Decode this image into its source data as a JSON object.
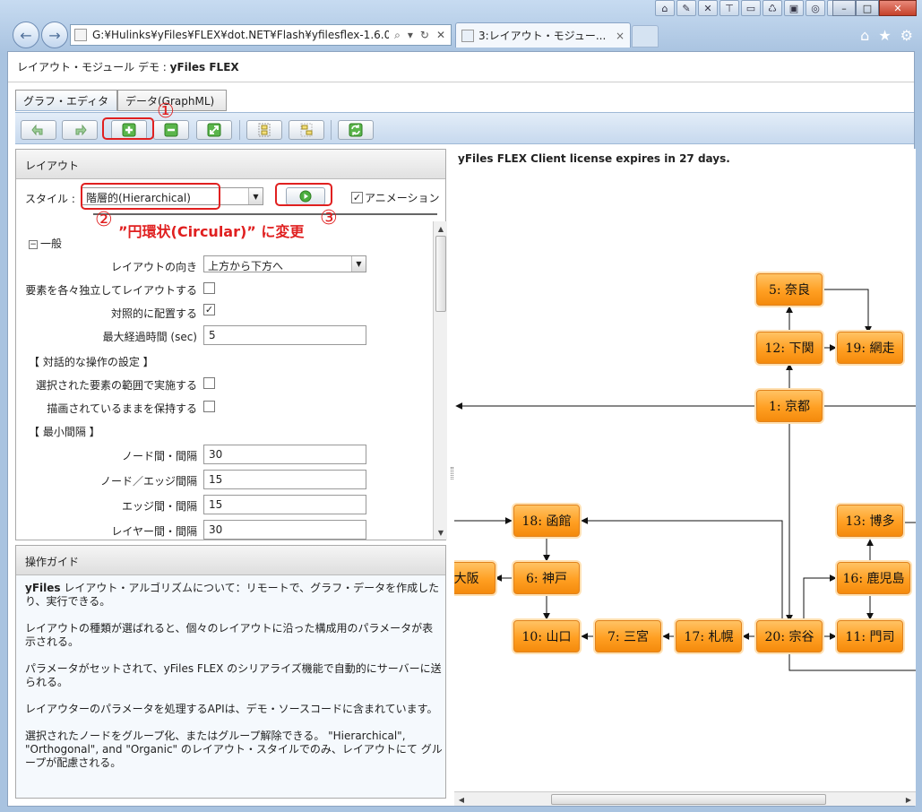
{
  "browser": {
    "address": "G:¥Hulinks¥yFiles¥FLEX¥dot.NET¥Flash¥yfilesflex-1.6.0.",
    "tab_title": "3:レイアウト・モジュー...",
    "tab_close": "×"
  },
  "app": {
    "title_prefix": "レイアウト・モジュール デモ : ",
    "title_product": "yFiles FLEX",
    "tabs": [
      "グラフ・エディタ",
      "データ(GraphML)"
    ]
  },
  "layout_panel": {
    "header": "レイアウト",
    "style_label": "スタイル :",
    "style_value": "階層的(Hierarchical)",
    "animation_label": "アニメーション",
    "animation_checked": true,
    "section_general": "一般",
    "rows": [
      {
        "label": "レイアウトの向き",
        "type": "select",
        "value": "上方から下方へ"
      },
      {
        "label": "要素を各々独立してレイアウトする",
        "type": "checkbox",
        "checked": false
      },
      {
        "label": "対照的に配置する",
        "type": "checkbox",
        "checked": true
      },
      {
        "label": "最大経過時間 (sec)",
        "type": "input",
        "value": "5"
      },
      {
        "label": "【 対話的な操作の設定 】",
        "type": "section"
      },
      {
        "label": "選択された要素の範囲で実施する",
        "type": "checkbox",
        "checked": false
      },
      {
        "label": "描画されているままを保持する",
        "type": "checkbox",
        "checked": false
      },
      {
        "label": "【 最小間隔 】",
        "type": "section"
      },
      {
        "label": "ノード間・間隔",
        "type": "input",
        "value": "30"
      },
      {
        "label": "ノード／エッジ間隔",
        "type": "input",
        "value": "15"
      },
      {
        "label": "エッジ間・間隔",
        "type": "input",
        "value": "15"
      },
      {
        "label": "レイヤー間・間隔",
        "type": "input",
        "value": "30"
      }
    ]
  },
  "guide_panel": {
    "header": "操作ガイド",
    "p1_bold": "yFiles",
    "p1": " レイアウト・アルゴリズムについて：リモートで、グラフ・データを作成したり、実行できる。",
    "p2": "レイアウトの種類が選ばれると、個々のレイアウトに沿った構成用のパラメータが表示される。",
    "p3": "パラメータがセットされて、yFiles FLEX のシリアライズ機能で自動的にサーバーに送られる。",
    "p4": "レイアウターのパラメータを処理するAPIは、デモ・ソースコードに含まれています。",
    "p5": "選択されたノードをグループ化、またはグループ解除できる。 \"Hierarchical\", \"Orthogonal\", and \"Organic\" のレイアウト・スタイルでのみ、レイアウトにて グループが配慮される。"
  },
  "canvas": {
    "license": "yFiles FLEX Client license expires in 27 days.",
    "nodes": [
      {
        "id": "n5",
        "label": "5: 奈良"
      },
      {
        "id": "n12",
        "label": "12: 下関"
      },
      {
        "id": "n19",
        "label": "19: 網走"
      },
      {
        "id": "n1",
        "label": "1: 京都"
      },
      {
        "id": "n18",
        "label": "18: 函館"
      },
      {
        "id": "n13",
        "label": "13: 博多"
      },
      {
        "id": "nosaka",
        "label": ": 大阪"
      },
      {
        "id": "n6",
        "label": "6: 神戸"
      },
      {
        "id": "n16",
        "label": "16: 鹿児島"
      },
      {
        "id": "n10",
        "label": "10: 山口"
      },
      {
        "id": "n7",
        "label": "7: 三宮"
      },
      {
        "id": "n17",
        "label": "17: 札幌"
      },
      {
        "id": "n20",
        "label": "20: 宗谷"
      },
      {
        "id": "n11",
        "label": "11: 門司"
      }
    ]
  },
  "annotations": {
    "n1": "①",
    "n2": "②",
    "n3": "③",
    "instruction": "”円環状(Circular)” に変更",
    "color": "#e02020"
  },
  "colors": {
    "node_fill": "#ff9f22",
    "node_border": "#e1821c",
    "accent": "#e02020"
  }
}
